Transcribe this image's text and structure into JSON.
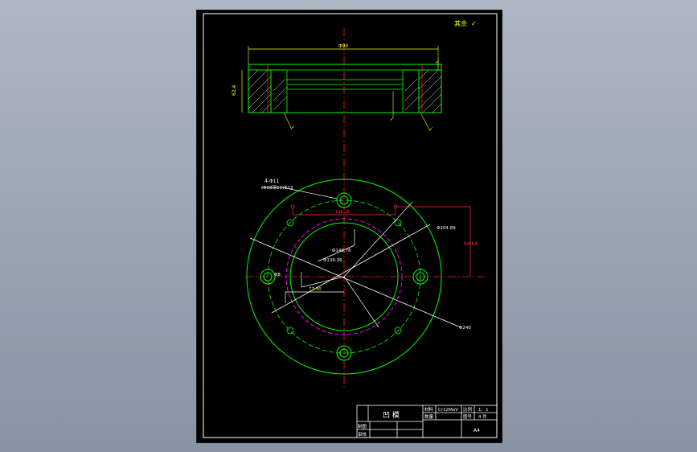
{
  "drawing": {
    "corner_note": "其余",
    "roughness_symbol": "✓",
    "section": {
      "top_dim": "Φ90",
      "height_dim": "62.4"
    },
    "plan": {
      "hole_note_line1": "4-Φ11",
      "hole_note_line2": "(Φ18深11)Φ12",
      "dim_top_chord": "135.28",
      "dim_outer_dia": "Φ204.89",
      "dim_right_offset": "94.64",
      "dim_inner_1": "Φ149.76",
      "dim_inner_2": "Φ139.36",
      "dim_small": "Φ8",
      "dim_radius": "77.30",
      "dim_outer": "Φ240"
    }
  },
  "title_block": {
    "part_name": "凹 模",
    "material_label": "材料",
    "material": "Cr12MoV",
    "scale_label": "比例",
    "scale": "1：1",
    "qty_label": "数量",
    "drawing_no_label": "图号",
    "drawing_no": "4 件",
    "designer_label": "制图",
    "checker_label": "审核",
    "sheet_size": "A4"
  },
  "colors": {
    "sheet_bg": "#000000",
    "outline": "#ffffff",
    "geometry": "#00ff00",
    "dimension": "#ffff00",
    "centerline": "#ff0000",
    "hidden": "#ff00ff"
  }
}
